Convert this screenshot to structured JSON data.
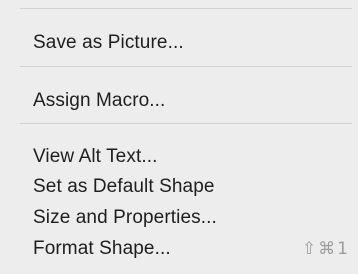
{
  "menu": {
    "items": [
      {
        "label": "Save as Picture..."
      },
      {
        "label": "Assign Macro..."
      },
      {
        "label": "View Alt Text..."
      },
      {
        "label": "Set as Default Shape"
      },
      {
        "label": "Size and Properties..."
      },
      {
        "label": "Format Shape...",
        "shortcut": "⇧⌘1"
      }
    ]
  }
}
